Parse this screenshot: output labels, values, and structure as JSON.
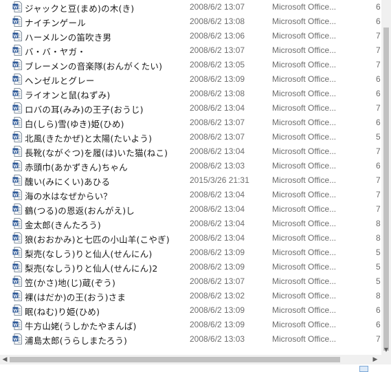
{
  "files": [
    {
      "name": "ジャックと豆(まめ)の木(き)",
      "date": "2008/6/2 13:07",
      "type": "Microsoft Office...",
      "size": "6"
    },
    {
      "name": "ナイチンゲール",
      "date": "2008/6/2 13:08",
      "type": "Microsoft Office...",
      "size": "6"
    },
    {
      "name": "ハーメルンの笛吹き男",
      "date": "2008/6/2 13:06",
      "type": "Microsoft Office...",
      "size": "7"
    },
    {
      "name": "バ・バ・ヤガ・",
      "date": "2008/6/2 13:07",
      "type": "Microsoft Office...",
      "size": "7"
    },
    {
      "name": "ブレーメンの音楽隊(おんがくたい)",
      "date": "2008/6/2 13:05",
      "type": "Microsoft Office...",
      "size": "7"
    },
    {
      "name": "ヘンゼルとグレー",
      "date": "2008/6/2 13:09",
      "type": "Microsoft Office...",
      "size": "6"
    },
    {
      "name": "ライオンと鼠(ねずみ)",
      "date": "2008/6/2 13:08",
      "type": "Microsoft Office...",
      "size": "6"
    },
    {
      "name": "ロバの耳(みみ)の王子(おうじ)",
      "date": "2008/6/2 13:04",
      "type": "Microsoft Office...",
      "size": "7"
    },
    {
      "name": "白(しら)雪(ゆき)姫(ひめ)",
      "date": "2008/6/2 13:07",
      "type": "Microsoft Office...",
      "size": "6"
    },
    {
      "name": "北風(きたかぜ)と太陽(たいよう)",
      "date": "2008/6/2 13:07",
      "type": "Microsoft Office...",
      "size": "5"
    },
    {
      "name": "長靴(ながぐつ)を履(は)いた猫(ねこ)",
      "date": "2008/6/2 13:04",
      "type": "Microsoft Office...",
      "size": "7"
    },
    {
      "name": "赤頭巾(あかずきん)ちゃん",
      "date": "2008/6/2 13:03",
      "type": "Microsoft Office...",
      "size": "6"
    },
    {
      "name": "醜い(みにくい)あひる",
      "date": "2015/3/26 21:31",
      "type": "Microsoft Office...",
      "size": "7"
    },
    {
      "name": "海の水はなぜからい？",
      "date": "2008/6/2 13:04",
      "type": "Microsoft Office...",
      "size": "7"
    },
    {
      "name": "鶴(つる)の恩返(おんがえ)し",
      "date": "2008/6/2 13:04",
      "type": "Microsoft Office...",
      "size": "7"
    },
    {
      "name": "金太郎(きんたろう)",
      "date": "2008/6/2 13:04",
      "type": "Microsoft Office...",
      "size": "8"
    },
    {
      "name": "狼(おおかみ)と七匹の小山羊(こやぎ)",
      "date": "2008/6/2 13:04",
      "type": "Microsoft Office...",
      "size": "8"
    },
    {
      "name": "梨売(なしう)りと仙人(せんにん)",
      "date": "2008/6/2 13:09",
      "type": "Microsoft Office...",
      "size": "5"
    },
    {
      "name": "梨売(なしう)りと仙人(せんにん)2",
      "date": "2008/6/2 13:09",
      "type": "Microsoft Office...",
      "size": "5"
    },
    {
      "name": "笠(かさ)地(じ)蔵(ぞう)",
      "date": "2008/6/2 13:07",
      "type": "Microsoft Office...",
      "size": "5"
    },
    {
      "name": "裸(はだか)の王(おう)さま",
      "date": "2008/6/2 13:02",
      "type": "Microsoft Office...",
      "size": "8"
    },
    {
      "name": "眠(ねむ)り姫(ひめ)",
      "date": "2008/6/2 13:09",
      "type": "Microsoft Office...",
      "size": "6"
    },
    {
      "name": "牛方山姥(うしかたやまんば)",
      "date": "2008/6/2 13:09",
      "type": "Microsoft Office...",
      "size": "6"
    },
    {
      "name": "浦島太郎(うらしまたろう)",
      "date": "2008/6/2 13:03",
      "type": "Microsoft Office...",
      "size": "7"
    }
  ],
  "icons": {
    "file": "word-document-icon",
    "scroll_left": "chevron-left-icon",
    "scroll_right": "chevron-right-icon",
    "scroll_down": "chevron-down-icon"
  },
  "colors": {
    "word_icon": "#2b5797",
    "text": "#1a1a1a",
    "muted": "#6d6d6d",
    "scroll_track": "#f0f0f0",
    "scroll_thumb": "#c1c1c1"
  }
}
